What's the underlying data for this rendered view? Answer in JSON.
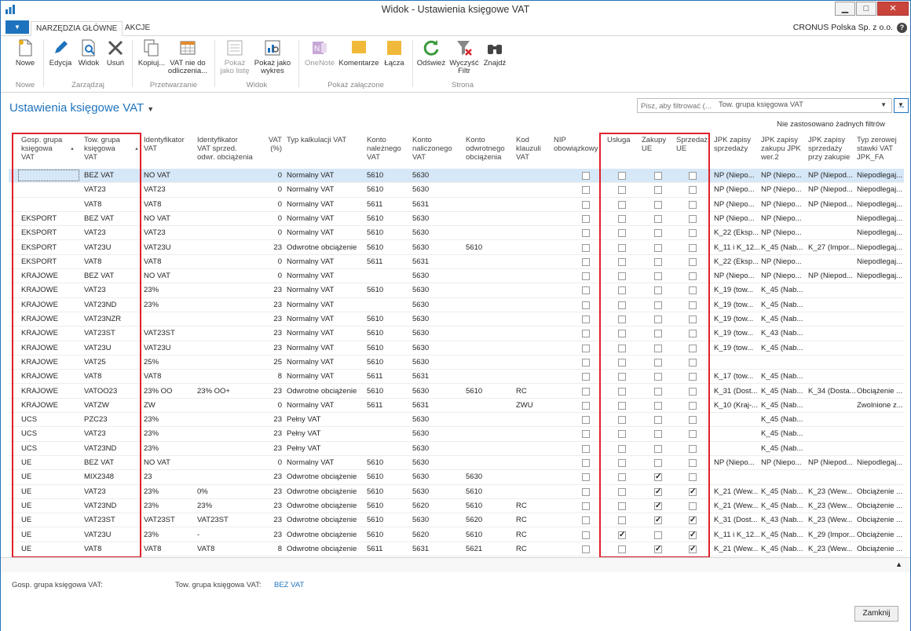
{
  "window": {
    "title": "Widok - Ustawienia księgowe VAT"
  },
  "tabs": [
    {
      "label": "NARZĘDZIA GŁÓWNE"
    },
    {
      "label": "AKCJE"
    }
  ],
  "company": "CRONUS Polska Sp. z o.o.",
  "ribbon": {
    "buttons": [
      {
        "label": "Nowe",
        "icon": "new-icon"
      },
      {
        "label": "Edycja",
        "icon": "edit-icon"
      },
      {
        "label": "Widok",
        "icon": "view-icon"
      },
      {
        "label": "Usuń",
        "icon": "delete-icon"
      },
      {
        "label": "Kopiuj...",
        "icon": "copy-icon"
      },
      {
        "label": "VAT nie do odliczenia...",
        "icon": "calendar-icon"
      },
      {
        "label": "Pokaż jako listę",
        "icon": "list-icon"
      },
      {
        "label": "Pokaż jako wykres",
        "icon": "chart-icon"
      },
      {
        "label": "OneNote",
        "icon": "onenote-icon"
      },
      {
        "label": "Komentarze",
        "icon": "comment-icon"
      },
      {
        "label": "Łącza",
        "icon": "link-icon"
      },
      {
        "label": "Odśwież",
        "icon": "refresh-icon"
      },
      {
        "label": "Wyczyść Filtr",
        "icon": "clear-filter-icon"
      },
      {
        "label": "Znajdź",
        "icon": "find-icon"
      }
    ],
    "groups": [
      "Nowe",
      "Zarządzaj",
      "Przetwarzanie",
      "Widok",
      "Pokaż załączone",
      "Strona"
    ]
  },
  "page_title": "Ustawienia księgowe VAT",
  "filter": {
    "placeholder": "Pisz, aby filtrować (...",
    "field": "Tow. grupa księgowa VAT",
    "status": "Nie zastosowano żadnych filtrów"
  },
  "columns": [
    [
      "Gosp. grupa",
      "księgowa",
      "VAT"
    ],
    [
      "Tow. grupa",
      "księgowa",
      "VAT"
    ],
    [
      "Identyfikator",
      "VAT"
    ],
    [
      "Identyfikator",
      "VAT sprzed.",
      "odwr. obciążenia"
    ],
    [
      "VAT",
      "(%)"
    ],
    [
      "Typ kalkulacji VAT"
    ],
    [
      "Konto",
      "należnego",
      "VAT"
    ],
    [
      "Konto",
      "naliczonego",
      "VAT"
    ],
    [
      "Konto",
      "odwrotnego",
      "obciążenia"
    ],
    [
      "Kod",
      "klauzuli",
      "VAT"
    ],
    [
      "NIP",
      "obowiązkowy"
    ],
    [
      "Usługa"
    ],
    [
      "Zakupy",
      "UE"
    ],
    [
      "Sprzedaż",
      "UE"
    ],
    [
      "JPK zapisy",
      "sprzedaży"
    ],
    [
      "JPK zapisy",
      "zakupu JPK",
      "wer.2"
    ],
    [
      "JPK zapisy",
      "sprzedaży",
      "przy zakupie"
    ],
    [
      "Typ zerowej",
      "stawki VAT",
      "JPK_FA"
    ]
  ],
  "rows": [
    [
      "",
      "BEZ VAT",
      "NO VAT",
      "",
      "0",
      "Normalny VAT",
      "5610",
      "5630",
      "",
      "",
      false,
      false,
      false,
      false,
      "NP (Niepo...",
      "NP (Niepo...",
      "NP (Niepod...",
      "Niepodlegaj..."
    ],
    [
      "",
      "VAT23",
      "VAT23",
      "",
      "0",
      "Normalny VAT",
      "5610",
      "5630",
      "",
      "",
      false,
      false,
      false,
      false,
      "NP (Niepo...",
      "NP (Niepo...",
      "NP (Niepod...",
      "Niepodlegaj..."
    ],
    [
      "",
      "VAT8",
      "VAT8",
      "",
      "0",
      "Normalny VAT",
      "5611",
      "5631",
      "",
      "",
      false,
      false,
      false,
      false,
      "NP (Niepo...",
      "NP (Niepo...",
      "NP (Niepod...",
      "Niepodlegaj..."
    ],
    [
      "EKSPORT",
      "BEZ VAT",
      "NO VAT",
      "",
      "0",
      "Normalny VAT",
      "5610",
      "5630",
      "",
      "",
      false,
      false,
      false,
      false,
      "NP (Niepo...",
      "NP (Niepo...",
      "",
      "Niepodlegaj..."
    ],
    [
      "EKSPORT",
      "VAT23",
      "VAT23",
      "",
      "0",
      "Normalny VAT",
      "5610",
      "5630",
      "",
      "",
      false,
      false,
      false,
      false,
      "K_22 (Eksp...",
      "NP (Niepo...",
      "",
      "Niepodlegaj..."
    ],
    [
      "EKSPORT",
      "VAT23U",
      "VAT23U",
      "",
      "23",
      "Odwrotne obciążenie",
      "5610",
      "5630",
      "5610",
      "",
      false,
      false,
      false,
      false,
      "K_11 i K_12...",
      "K_45 (Nab...",
      "K_27 (Impor...",
      "Niepodlegaj..."
    ],
    [
      "EKSPORT",
      "VAT8",
      "VAT8",
      "",
      "0",
      "Normalny VAT",
      "5611",
      "5631",
      "",
      "",
      false,
      false,
      false,
      false,
      "K_22 (Eksp...",
      "NP (Niepo...",
      "",
      "Niepodlegaj..."
    ],
    [
      "KRAJOWE",
      "BEZ VAT",
      "NO VAT",
      "",
      "0",
      "Normalny VAT",
      "",
      "5630",
      "",
      "",
      false,
      false,
      false,
      false,
      "NP (Niepo...",
      "NP (Niepo...",
      "NP (Niepod...",
      "Niepodlegaj..."
    ],
    [
      "KRAJOWE",
      "VAT23",
      "23%",
      "",
      "23",
      "Normalny VAT",
      "5610",
      "5630",
      "",
      "",
      false,
      false,
      false,
      false,
      "K_19 (tow...",
      "K_45 (Nab...",
      "",
      ""
    ],
    [
      "KRAJOWE",
      "VAT23ND",
      "23%",
      "",
      "23",
      "Normalny VAT",
      "",
      "5630",
      "",
      "",
      false,
      false,
      false,
      false,
      "K_19 (tow...",
      "K_45 (Nab...",
      "",
      ""
    ],
    [
      "KRAJOWE",
      "VAT23NZR",
      "",
      "",
      "23",
      "Normalny VAT",
      "5610",
      "5630",
      "",
      "",
      false,
      false,
      false,
      false,
      "K_19 (tow...",
      "K_45 (Nab...",
      "",
      ""
    ],
    [
      "KRAJOWE",
      "VAT23ST",
      "VAT23ST",
      "",
      "23",
      "Normalny VAT",
      "5610",
      "5630",
      "",
      "",
      false,
      false,
      false,
      false,
      "K_19 (tow...",
      "K_43 (Nab...",
      "",
      ""
    ],
    [
      "KRAJOWE",
      "VAT23U",
      "VAT23U",
      "",
      "23",
      "Normalny VAT",
      "5610",
      "5630",
      "",
      "",
      false,
      false,
      false,
      false,
      "K_19 (tow...",
      "K_45 (Nab...",
      "",
      ""
    ],
    [
      "KRAJOWE",
      "VAT25",
      "25%",
      "",
      "25",
      "Normalny VAT",
      "5610",
      "5630",
      "",
      "",
      false,
      false,
      false,
      false,
      "",
      "",
      "",
      ""
    ],
    [
      "KRAJOWE",
      "VAT8",
      "VAT8",
      "",
      "8",
      "Normalny VAT",
      "5611",
      "5631",
      "",
      "",
      false,
      false,
      false,
      false,
      "K_17 (tow...",
      "K_45 (Nab...",
      "",
      ""
    ],
    [
      "KRAJOWE",
      "VATOO23",
      "23% OO",
      "23% OO+",
      "23",
      "Odwrotne obciążenie",
      "5610",
      "5630",
      "5610",
      "RC",
      false,
      false,
      false,
      false,
      "K_31 (Dost...",
      "K_45 (Nab...",
      "K_34 (Dosta...",
      "Obciążenie ..."
    ],
    [
      "KRAJOWE",
      "VATZW",
      "ZW",
      "",
      "0",
      "Normalny VAT",
      "5611",
      "5631",
      "",
      "ZWU",
      false,
      false,
      false,
      false,
      "K_10 (Kraj-...",
      "K_45 (Nab...",
      "",
      "Zwolnione z..."
    ],
    [
      "UCS",
      "PZC23",
      "23%",
      "",
      "23",
      "Pełny VAT",
      "",
      "5630",
      "",
      "",
      false,
      false,
      false,
      false,
      "",
      "K_45 (Nab...",
      "",
      ""
    ],
    [
      "UCS",
      "VAT23",
      "23%",
      "",
      "23",
      "Pełny VAT",
      "",
      "5630",
      "",
      "",
      false,
      false,
      false,
      false,
      "",
      "K_45 (Nab...",
      "",
      ""
    ],
    [
      "UCS",
      "VAT23ND",
      "23%",
      "",
      "23",
      "Pełny VAT",
      "",
      "5630",
      "",
      "",
      false,
      false,
      false,
      false,
      "",
      "K_45 (Nab...",
      "",
      ""
    ],
    [
      "UE",
      "BEZ VAT",
      "NO VAT",
      "",
      "0",
      "Normalny VAT",
      "5610",
      "5630",
      "",
      "",
      false,
      false,
      false,
      false,
      "NP (Niepo...",
      "NP (Niepo...",
      "NP (Niepod...",
      "Niepodlegaj..."
    ],
    [
      "UE",
      "MIX2348",
      "23",
      "",
      "23",
      "Odwrotne obciążenie",
      "5610",
      "5630",
      "5630",
      "",
      false,
      false,
      true,
      false,
      "",
      "",
      "",
      ""
    ],
    [
      "UE",
      "VAT23",
      "23%",
      "0%",
      "23",
      "Odwrotne obciążenie",
      "5610",
      "5630",
      "5610",
      "",
      false,
      false,
      true,
      true,
      "K_21 (Wew...",
      "K_45 (Nab...",
      "K_23 (Wew...",
      "Obciążenie ..."
    ],
    [
      "UE",
      "VAT23ND",
      "23%",
      "23%",
      "23",
      "Odwrotne obciążenie",
      "5610",
      "5620",
      "5610",
      "RC",
      false,
      false,
      true,
      false,
      "K_21 (Wew...",
      "K_45 (Nab...",
      "K_23 (Wew...",
      "Obciążenie ..."
    ],
    [
      "UE",
      "VAT23ST",
      "VAT23ST",
      "VAT23ST",
      "23",
      "Odwrotne obciążenie",
      "5610",
      "5630",
      "5620",
      "RC",
      false,
      false,
      true,
      true,
      "K_31 (Dost...",
      "K_43 (Nab...",
      "K_23 (Wew...",
      "Obciążenie ..."
    ],
    [
      "UE",
      "VAT23U",
      "23%",
      "-",
      "23",
      "Odwrotne obciążenie",
      "5610",
      "5620",
      "5610",
      "RC",
      false,
      true,
      false,
      true,
      "K_11 i K_12...",
      "K_45 (Nab...",
      "K_29 (Impor...",
      "Obciążenie ..."
    ],
    [
      "UE",
      "VAT8",
      "VAT8",
      "VAT8",
      "8",
      "Odwrotne obciążenie",
      "5611",
      "5631",
      "5621",
      "RC",
      false,
      false,
      true,
      true,
      "K_21 (Wew...",
      "K_45 (Nab...",
      "K_23 (Wew...",
      "Obciążenie ..."
    ]
  ],
  "footer": {
    "gen_label": "Gosp. grupa księgowa VAT:",
    "gen_value": "",
    "prod_label": "Tow. grupa księgowa VAT:",
    "prod_value": "BEZ VAT",
    "close_label": "Zamknij"
  },
  "colors": {
    "accent": "#1e73be",
    "highlight": "#e0202a",
    "selected_row": "#d6e7f7"
  }
}
